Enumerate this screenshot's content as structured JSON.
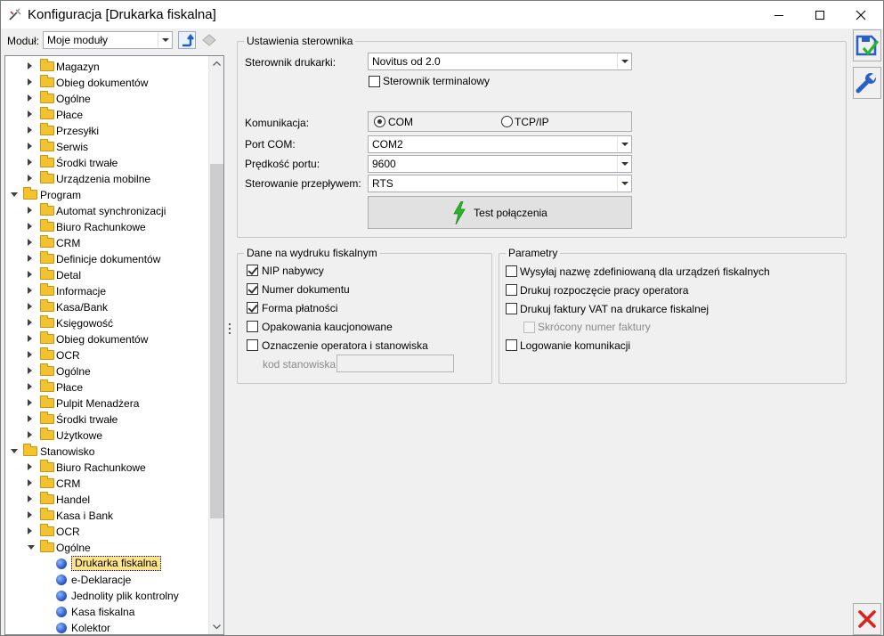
{
  "window": {
    "title": "Konfiguracja [Drukarka fiskalna]"
  },
  "module_bar": {
    "label": "Moduł:",
    "value": "Moje moduły"
  },
  "tree": {
    "items": [
      {
        "label": "Magazyn",
        "level": 2,
        "state": "closed",
        "icon": "folder-icon"
      },
      {
        "label": "Obieg dokumentów",
        "level": 2,
        "state": "closed",
        "icon": "folder-icon"
      },
      {
        "label": "Ogólne",
        "level": 2,
        "state": "closed",
        "icon": "folder-icon"
      },
      {
        "label": "Płace",
        "level": 2,
        "state": "closed",
        "icon": "folder-icon"
      },
      {
        "label": "Przesyłki",
        "level": 2,
        "state": "closed",
        "icon": "folder-icon"
      },
      {
        "label": "Serwis",
        "level": 2,
        "state": "closed",
        "icon": "folder-icon"
      },
      {
        "label": "Środki trwałe",
        "level": 2,
        "state": "closed",
        "icon": "folder-icon"
      },
      {
        "label": "Urządzenia mobilne",
        "level": 2,
        "state": "closed",
        "icon": "folder-icon"
      },
      {
        "label": "Program",
        "level": 1,
        "state": "open",
        "icon": "folder-icon"
      },
      {
        "label": "Automat synchronizacji",
        "level": 2,
        "state": "closed",
        "icon": "folder-icon"
      },
      {
        "label": "Biuro Rachunkowe",
        "level": 2,
        "state": "closed",
        "icon": "folder-icon"
      },
      {
        "label": "CRM",
        "level": 2,
        "state": "closed",
        "icon": "folder-icon"
      },
      {
        "label": "Definicje dokumentów",
        "level": 2,
        "state": "closed",
        "icon": "folder-icon"
      },
      {
        "label": "Detal",
        "level": 2,
        "state": "closed",
        "icon": "folder-icon"
      },
      {
        "label": "Informacje",
        "level": 2,
        "state": "closed",
        "icon": "folder-icon"
      },
      {
        "label": "Kasa/Bank",
        "level": 2,
        "state": "closed",
        "icon": "folder-icon"
      },
      {
        "label": "Księgowość",
        "level": 2,
        "state": "closed",
        "icon": "folder-icon"
      },
      {
        "label": "Obieg dokumentów",
        "level": 2,
        "state": "closed",
        "icon": "folder-icon"
      },
      {
        "label": "OCR",
        "level": 2,
        "state": "closed",
        "icon": "folder-icon"
      },
      {
        "label": "Ogólne",
        "level": 2,
        "state": "closed",
        "icon": "folder-icon"
      },
      {
        "label": "Płace",
        "level": 2,
        "state": "closed",
        "icon": "folder-icon"
      },
      {
        "label": "Pulpit Menadżera",
        "level": 2,
        "state": "closed",
        "icon": "folder-icon"
      },
      {
        "label": "Środki trwałe",
        "level": 2,
        "state": "closed",
        "icon": "folder-icon"
      },
      {
        "label": "Użytkowe",
        "level": 2,
        "state": "closed",
        "icon": "folder-icon"
      },
      {
        "label": "Stanowisko",
        "level": 1,
        "state": "open",
        "icon": "folder-icon"
      },
      {
        "label": "Biuro Rachunkowe",
        "level": 2,
        "state": "closed",
        "icon": "folder-icon"
      },
      {
        "label": "CRM",
        "level": 2,
        "state": "closed",
        "icon": "folder-icon"
      },
      {
        "label": "Handel",
        "level": 2,
        "state": "closed",
        "icon": "folder-icon"
      },
      {
        "label": "Kasa i Bank",
        "level": 2,
        "state": "closed",
        "icon": "folder-icon"
      },
      {
        "label": "OCR",
        "level": 2,
        "state": "closed",
        "icon": "folder-icon"
      },
      {
        "label": "Ogólne",
        "level": 2,
        "state": "open",
        "icon": "folder-icon"
      },
      {
        "label": "Drukarka fiskalna",
        "level": 3,
        "state": "leaf",
        "icon": "settings-leaf-icon",
        "selected": true
      },
      {
        "label": "e-Deklaracje",
        "level": 3,
        "state": "leaf",
        "icon": "settings-leaf-icon"
      },
      {
        "label": "Jednolity plik kontrolny",
        "level": 3,
        "state": "leaf",
        "icon": "settings-leaf-icon"
      },
      {
        "label": "Kasa fiskalna",
        "level": 3,
        "state": "leaf",
        "icon": "settings-leaf-icon"
      },
      {
        "label": "Kolektor",
        "level": 3,
        "state": "leaf",
        "icon": "settings-leaf-icon"
      }
    ]
  },
  "controller": {
    "group_title": "Ustawienia sterownika",
    "driver_label": "Sterownik drukarki:",
    "driver_value": "Novitus od 2.0",
    "terminal_driver_label": "Sterownik terminalowy",
    "terminal_driver_checked": false,
    "comm_label": "Komunikacja:",
    "comm_options": [
      "COM",
      "TCP/IP"
    ],
    "comm_selected": "COM",
    "port_label": "Port COM:",
    "port_value": "COM2",
    "speed_label": "Prędkość portu:",
    "speed_value": "9600",
    "flow_label": "Sterowanie przepływem:",
    "flow_value": "RTS",
    "test_button_label": "Test połączenia"
  },
  "fiscal_print": {
    "group_title": "Dane na wydruku fiskalnym",
    "options": [
      {
        "label": "NIP nabywcy",
        "checked": true
      },
      {
        "label": "Numer dokumentu",
        "checked": true
      },
      {
        "label": "Forma płatności",
        "checked": true
      },
      {
        "label": "Opakowania kaucjonowane",
        "checked": false
      },
      {
        "label": "Oznaczenie operatora i stanowiska",
        "checked": false
      }
    ],
    "station_code_label": "kod stanowiska:",
    "station_code_value": ""
  },
  "parameters": {
    "group_title": "Parametry",
    "options": [
      {
        "label": "Wysyłaj nazwę zdefiniowaną dla urządzeń fiskalnych",
        "checked": false
      },
      {
        "label": "Drukuj rozpoczęcie pracy operatora",
        "checked": false
      },
      {
        "label": "Drukuj faktury VAT na drukarce fiskalnej",
        "checked": false
      },
      {
        "label": "Skrócony numer faktury",
        "checked": false,
        "disabled": true
      },
      {
        "label": "Logowanie komunikacji",
        "checked": false
      }
    ]
  },
  "colors": {
    "selection": "#ffe38a",
    "save_icon_blue": "#2a5fc4",
    "cancel_icon_red": "#d9231e",
    "test_icon_green": "#2bb52b"
  }
}
